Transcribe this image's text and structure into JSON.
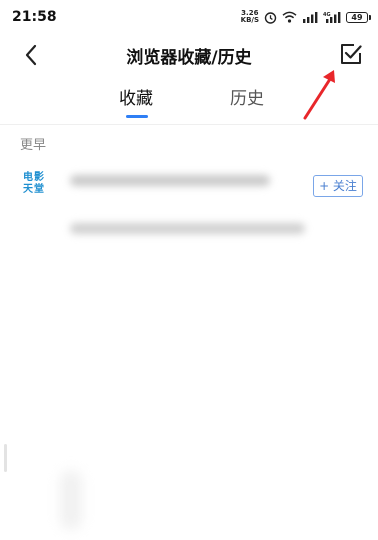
{
  "status_bar": {
    "time": "21:58",
    "net_speed_value": "3.26",
    "net_speed_unit": "KB/S",
    "battery": "49",
    "icons": [
      "alarm-icon",
      "wifi-icon",
      "signal-icon",
      "signal-4g-icon",
      "battery-icon"
    ]
  },
  "header": {
    "title": "浏览器收藏/历史",
    "back_icon": "chevron-left-icon",
    "edit_icon": "checkbox-edit-icon"
  },
  "tabs": [
    {
      "label": "收藏",
      "active": true
    },
    {
      "label": "历史",
      "active": false
    }
  ],
  "section": {
    "label": "更早"
  },
  "list": {
    "items": [
      {
        "logo_text_line1": "电影",
        "logo_text_line2": "天堂",
        "follow_label": "+ 关注"
      }
    ]
  },
  "colors": {
    "accent": "#2f7ff5",
    "logo": "#1f8fd0",
    "annotation": "#e8262a"
  }
}
